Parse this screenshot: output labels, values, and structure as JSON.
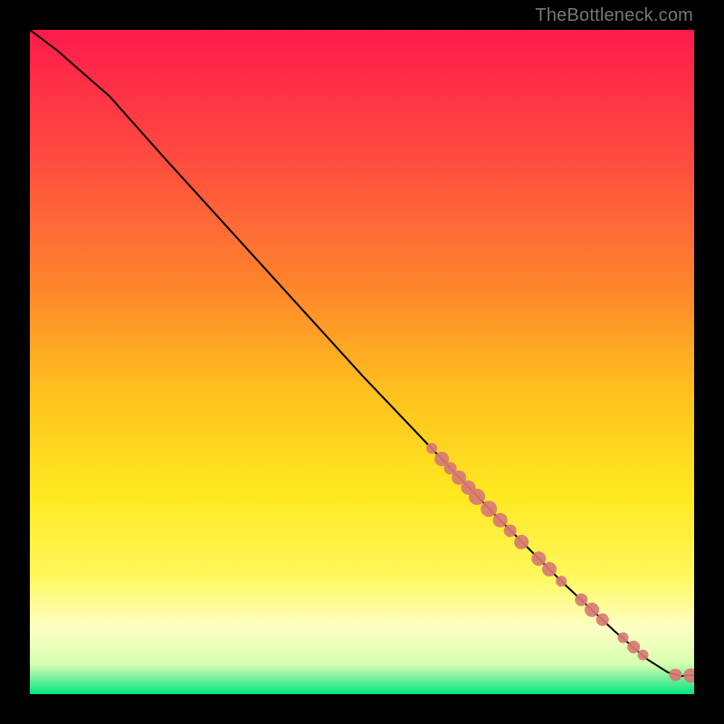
{
  "attribution": "TheBottleneck.com",
  "chart_data": {
    "type": "line",
    "title": "",
    "xlabel": "",
    "ylabel": "",
    "xlim": [
      0,
      100
    ],
    "ylim": [
      0,
      100
    ],
    "grid": false,
    "legend": false,
    "gradient_stops": [
      {
        "pos": 0.0,
        "color": "#ff1a4b"
      },
      {
        "pos": 0.2,
        "color": "#ff4d3f"
      },
      {
        "pos": 0.4,
        "color": "#ff8a2a"
      },
      {
        "pos": 0.55,
        "color": "#ffc21e"
      },
      {
        "pos": 0.7,
        "color": "#ffe820"
      },
      {
        "pos": 0.82,
        "color": "#fff85a"
      },
      {
        "pos": 0.9,
        "color": "#fdffc4"
      },
      {
        "pos": 0.955,
        "color": "#d6ffb0"
      },
      {
        "pos": 0.975,
        "color": "#7df0a0"
      },
      {
        "pos": 1.0,
        "color": "#00e681"
      }
    ],
    "series": [
      {
        "name": "curve",
        "type": "line",
        "color": "#000000",
        "x": [
          0,
          4,
          8,
          12,
          20,
          30,
          40,
          50,
          60,
          70,
          80,
          88,
          93,
          96,
          98,
          100
        ],
        "y": [
          100,
          97,
          93.5,
          90,
          81,
          70,
          59,
          48,
          37.5,
          27,
          17,
          9.5,
          5.2,
          3.3,
          2.7,
          2.9
        ]
      },
      {
        "name": "markers",
        "type": "scatter",
        "color": "#d87a73",
        "points": [
          {
            "x": 60.5,
            "y": 37.0,
            "r": 6
          },
          {
            "x": 62.0,
            "y": 35.4,
            "r": 8
          },
          {
            "x": 63.3,
            "y": 34.0,
            "r": 7
          },
          {
            "x": 64.6,
            "y": 32.6,
            "r": 8
          },
          {
            "x": 66.0,
            "y": 31.1,
            "r": 8
          },
          {
            "x": 67.3,
            "y": 29.7,
            "r": 9
          },
          {
            "x": 69.1,
            "y": 27.9,
            "r": 9
          },
          {
            "x": 70.8,
            "y": 26.2,
            "r": 8
          },
          {
            "x": 72.3,
            "y": 24.6,
            "r": 7
          },
          {
            "x": 74.0,
            "y": 22.9,
            "r": 8
          },
          {
            "x": 76.6,
            "y": 20.4,
            "r": 8
          },
          {
            "x": 78.2,
            "y": 18.8,
            "r": 8
          },
          {
            "x": 80.0,
            "y": 17.0,
            "r": 6
          },
          {
            "x": 83.0,
            "y": 14.2,
            "r": 7
          },
          {
            "x": 84.6,
            "y": 12.7,
            "r": 8
          },
          {
            "x": 86.2,
            "y": 11.2,
            "r": 7
          },
          {
            "x": 89.3,
            "y": 8.5,
            "r": 6
          },
          {
            "x": 90.9,
            "y": 7.1,
            "r": 7
          },
          {
            "x": 92.3,
            "y": 5.9,
            "r": 6
          },
          {
            "x": 97.2,
            "y": 2.9,
            "r": 7
          },
          {
            "x": 99.5,
            "y": 2.8,
            "r": 8
          },
          {
            "x": 101.0,
            "y": 3.0,
            "r": 7
          }
        ]
      }
    ]
  }
}
